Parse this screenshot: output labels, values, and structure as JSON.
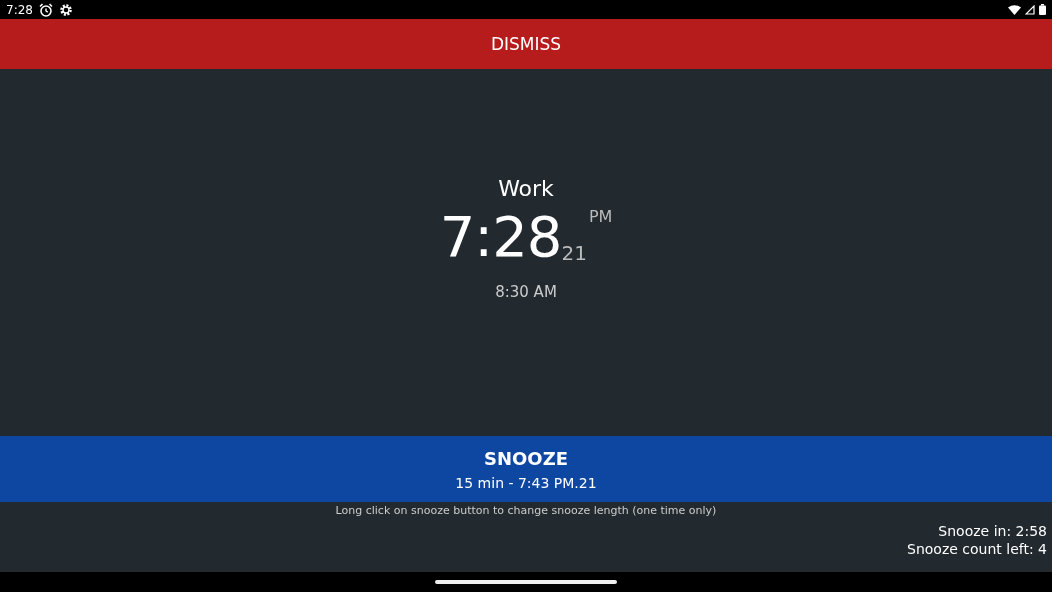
{
  "status_bar": {
    "time": "7:28"
  },
  "dismiss_button": {
    "label": "DISMISS"
  },
  "alarm": {
    "label": "Work",
    "time": "7:28",
    "seconds": "21",
    "meridiem": "PM",
    "alarm_time": "8:30 AM"
  },
  "snooze_button": {
    "label": "SNOOZE",
    "detail": "15 min - 7:43 PM.21"
  },
  "hint": "Long click on snooze button to change snooze length (one time only)",
  "snooze_info": [
    "Snooze in: 2:58",
    "Snooze count left: 4"
  ]
}
